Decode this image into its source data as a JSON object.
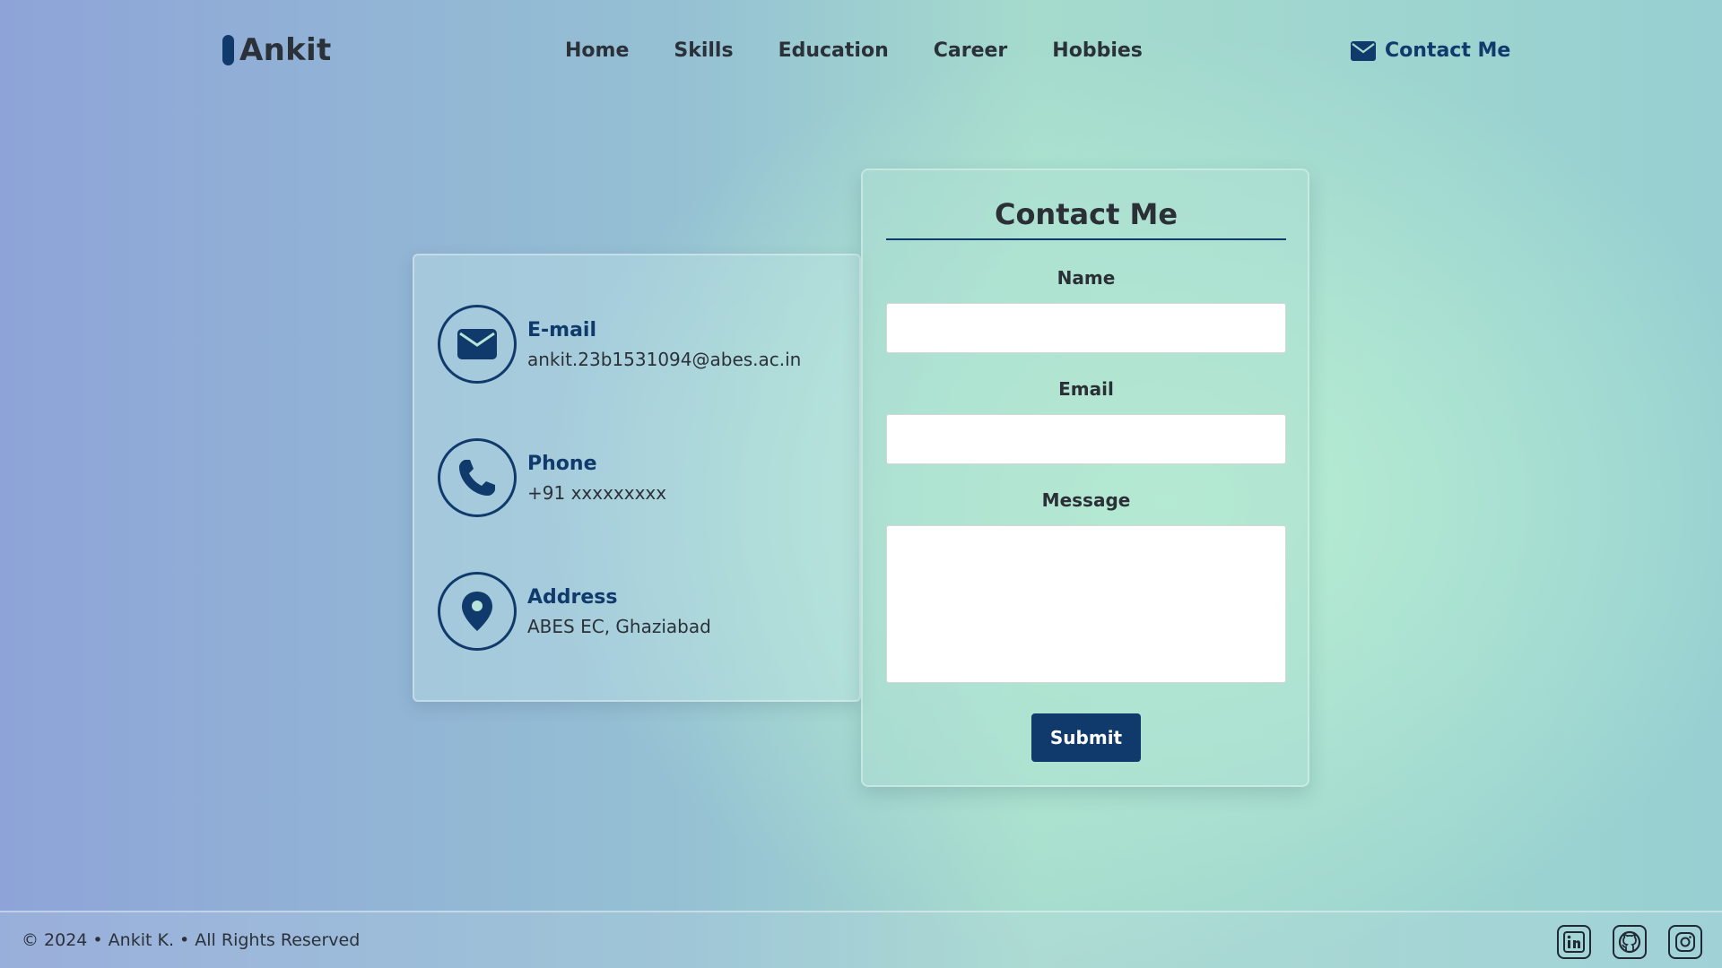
{
  "header": {
    "logo": "Ankit",
    "nav": [
      "Home",
      "Skills",
      "Education",
      "Career",
      "Hobbies"
    ],
    "contact_label": "Contact Me"
  },
  "info": {
    "email": {
      "title": "E-mail",
      "value": "ankit.23b1531094@abes.ac.in",
      "icon": "envelope-icon"
    },
    "phone": {
      "title": "Phone",
      "value": "+91 xxxxxxxxx",
      "icon": "phone-icon"
    },
    "address": {
      "title": "Address",
      "value": "ABES EC, Ghaziabad",
      "icon": "map-pin-icon"
    }
  },
  "form": {
    "title": "Contact Me",
    "name_label": "Name",
    "email_label": "Email",
    "message_label": "Message",
    "name_value": "",
    "email_value": "",
    "message_value": "",
    "submit_label": "Submit"
  },
  "footer": {
    "copyright": "© 2024 • Ankit K. • All Rights Reserved",
    "social": [
      "linkedin-icon",
      "github-icon",
      "instagram-icon"
    ]
  },
  "colors": {
    "primary": "#0f3a6b",
    "text": "#2b3138"
  }
}
